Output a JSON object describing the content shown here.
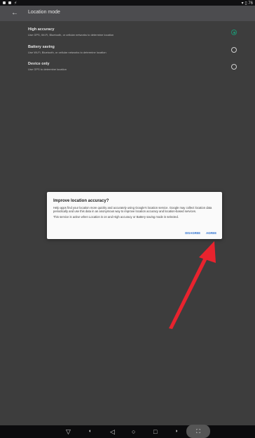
{
  "status_bar": {
    "right_text": "▾ ▯ 76"
  },
  "app_bar": {
    "back_icon": "arrow-back-icon",
    "title": "Location mode"
  },
  "options": [
    {
      "label": "High accuracy",
      "desc": "Use GPS, Wi-Fi, Bluetooth, or cellular networks to determine location",
      "checked": true
    },
    {
      "label": "Battery saving",
      "desc": "Use Wi-Fi, Bluetooth, or cellular networks to determine location",
      "checked": false
    },
    {
      "label": "Device only",
      "desc": "Use GPS to determine location",
      "checked": false
    }
  ],
  "dialog": {
    "title": "Improve location accuracy?",
    "body1": "Help apps find your location more quickly and accurately using Google's location service. Google may collect location data periodically and use this data in an anonymous way to improve location accuracy and location-based services.",
    "body2": "This service is active when Location is on and High accuracy or Battery saving mode is selected.",
    "disagree_label": "DISAGREE",
    "agree_label": "AGREE"
  },
  "annotation": {
    "color": "#e8232e"
  },
  "nav_bar": {
    "items": [
      "▽",
      "◁",
      "○",
      "□"
    ],
    "pill_label": "⛶"
  },
  "colors": {
    "accent": "#1f8f6f",
    "button": "#2a6fcf"
  }
}
